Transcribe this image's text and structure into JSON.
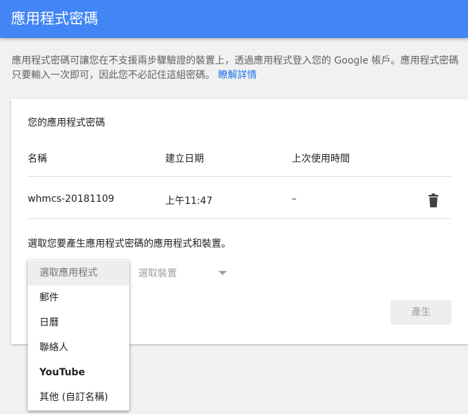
{
  "header": {
    "title": "應用程式密碼"
  },
  "intro": {
    "text": "應用程式密碼可讓您在不支援兩步驟驗證的裝置上，透過應用程式登入您的 Google 帳戶。應用程式密碼只要輸入一次即可，因此您不必記住這組密碼。",
    "link": "瞭解詳情"
  },
  "card": {
    "title": "您的應用程式密碼",
    "columns": {
      "name": "名稱",
      "created": "建立日期",
      "last_used": "上次使用時間"
    },
    "rows": [
      {
        "name": "whmcs-20181109",
        "created": "上午11:47",
        "last_used": "–",
        "delete_icon": "trash-icon"
      }
    ],
    "select_prompt": "選取您要產生應用程式密碼的應用程式和裝置。",
    "device_select": {
      "label": "選取裝置"
    },
    "generate_label": "產生"
  },
  "app_menu": {
    "items": [
      "選取應用程式",
      "郵件",
      "日曆",
      "聯絡人",
      "YouTube",
      "其他 (自訂名稱)"
    ]
  },
  "colors": {
    "header_blue": "#4285f4",
    "link_blue": "#1a73e8"
  }
}
